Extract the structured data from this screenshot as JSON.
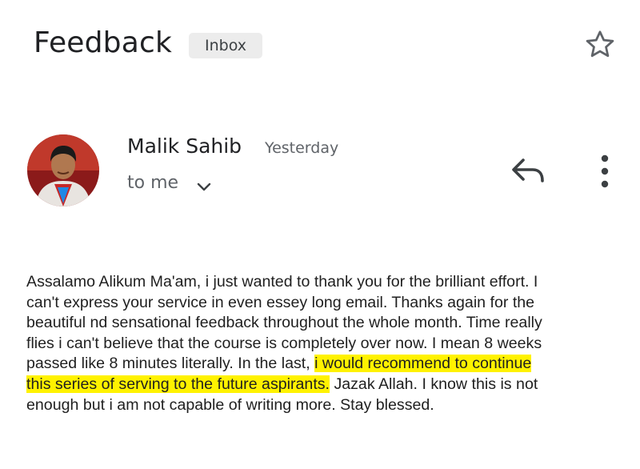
{
  "header": {
    "subject": "Feedback",
    "label": "Inbox",
    "star_icon": "star-outline-icon"
  },
  "message": {
    "avatar_icon": "sender-avatar",
    "sender": "Malik Sahib",
    "time": "Yesterday",
    "recipient": "to me",
    "chevron_icon": "chevron-down-icon",
    "reply_icon": "reply-icon",
    "more_icon": "more-vert-icon",
    "body_lines": [
      {
        "before": "Assalamo Alikum Ma'am, i just wanted to thank you for the brilliant effort. I",
        "highlight": "",
        "after": ""
      },
      {
        "before": "can't express your service in even essey long email. Thanks again for the",
        "highlight": "",
        "after": ""
      },
      {
        "before": "beautiful nd sensational feedback throughout the whole month. Time really",
        "highlight": "",
        "after": ""
      },
      {
        "before": "flies i can't believe that the course is completely over now. I mean 8 weeks",
        "highlight": "",
        "after": ""
      },
      {
        "before": "passed like 8 minutes literally. In the last, ",
        "highlight": "i would recommend to continue",
        "after": ""
      },
      {
        "before": "",
        "highlight": "this series of serving to the future aspirants.",
        "after": " Jazak Allah. I know this is not"
      },
      {
        "before": "enough but i am not capable of writing more. Stay blessed.",
        "highlight": "",
        "after": ""
      }
    ],
    "highlight_color": "#fff200"
  }
}
